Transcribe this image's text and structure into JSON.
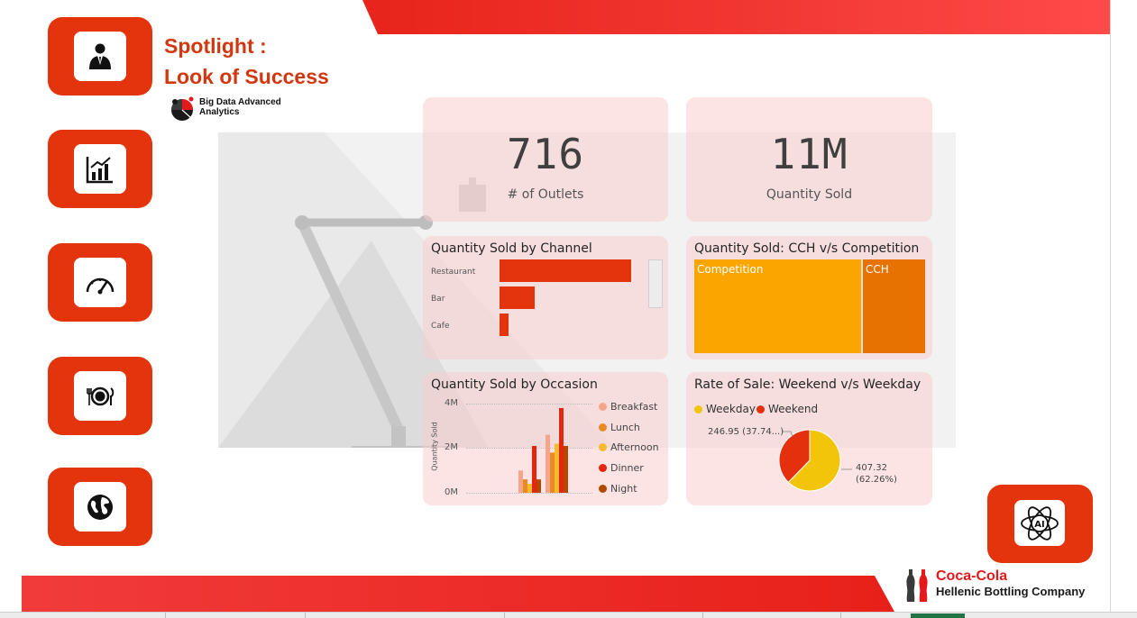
{
  "header": {
    "title_line1": "Spotlight :",
    "title_line2": "Look of Success",
    "bda_line1": "Big Data Advanced",
    "bda_line2": "Analytics"
  },
  "sidebar": {
    "items": [
      {
        "icon": "business-person-icon"
      },
      {
        "icon": "bar-chart-icon"
      },
      {
        "icon": "speedometer-icon"
      },
      {
        "icon": "dining-icon"
      },
      {
        "icon": "globe-icon"
      }
    ]
  },
  "kpis": {
    "outlets": {
      "value": "716",
      "label": "# of Outlets"
    },
    "quantity": {
      "value": "11M",
      "label": "Quantity Sold"
    }
  },
  "channel": {
    "title": "Quantity Sold by Channel",
    "chart_data": {
      "type": "bar",
      "orientation": "horizontal",
      "categories": [
        "Restaurant",
        "Bar",
        "Cafe"
      ],
      "values": [
        5.6,
        1.5,
        0.4
      ],
      "color": "#e3340c"
    }
  },
  "competition": {
    "title": "Quantity Sold: CCH v/s Competition",
    "chart_data": {
      "type": "treemap",
      "categories": [
        "Competition",
        "CCH"
      ],
      "values": [
        7.0,
        2.6
      ],
      "colors": [
        "#fba600",
        "#e87200"
      ]
    }
  },
  "occasion": {
    "title": "Quantity Sold by Occasion",
    "chart_data": {
      "type": "bar",
      "ylabel": "Quantity Sold",
      "yticks": [
        "4M",
        "2M",
        "0M"
      ],
      "ylim": [
        0,
        4
      ],
      "legend": [
        "Breakfast",
        "Lunch",
        "Afternoon",
        "Dinner",
        "Night"
      ],
      "colors": [
        "#f4a58a",
        "#ea8a24",
        "#f9b92e",
        "#e3260d",
        "#b14a00"
      ],
      "groups": [
        [
          1.0,
          0.6,
          0.4,
          2.1,
          0.6
        ],
        [
          2.6,
          1.8,
          2.2,
          3.8,
          2.1
        ]
      ]
    }
  },
  "rate": {
    "title": "Rate of Sale: Weekend v/s Weekday",
    "legend": [
      {
        "label": "Weekday",
        "color": "#f2c50a"
      },
      {
        "label": "Weekend",
        "color": "#e5300e"
      }
    ],
    "chart_data": {
      "type": "pie",
      "categories": [
        "Weekday",
        "Weekend"
      ],
      "values": [
        407.32,
        246.95
      ],
      "colors": [
        "#f2c50a",
        "#e5300e"
      ]
    },
    "weekend_label": "246.95 (37.74...)",
    "weekday_label_1": "407.32",
    "weekday_label_2": "(62.26%)"
  },
  "ai": {
    "icon": "ai-atom-icon"
  },
  "brand": {
    "name": "Coca-Cola",
    "sub": "Hellenic Bottling Company"
  }
}
